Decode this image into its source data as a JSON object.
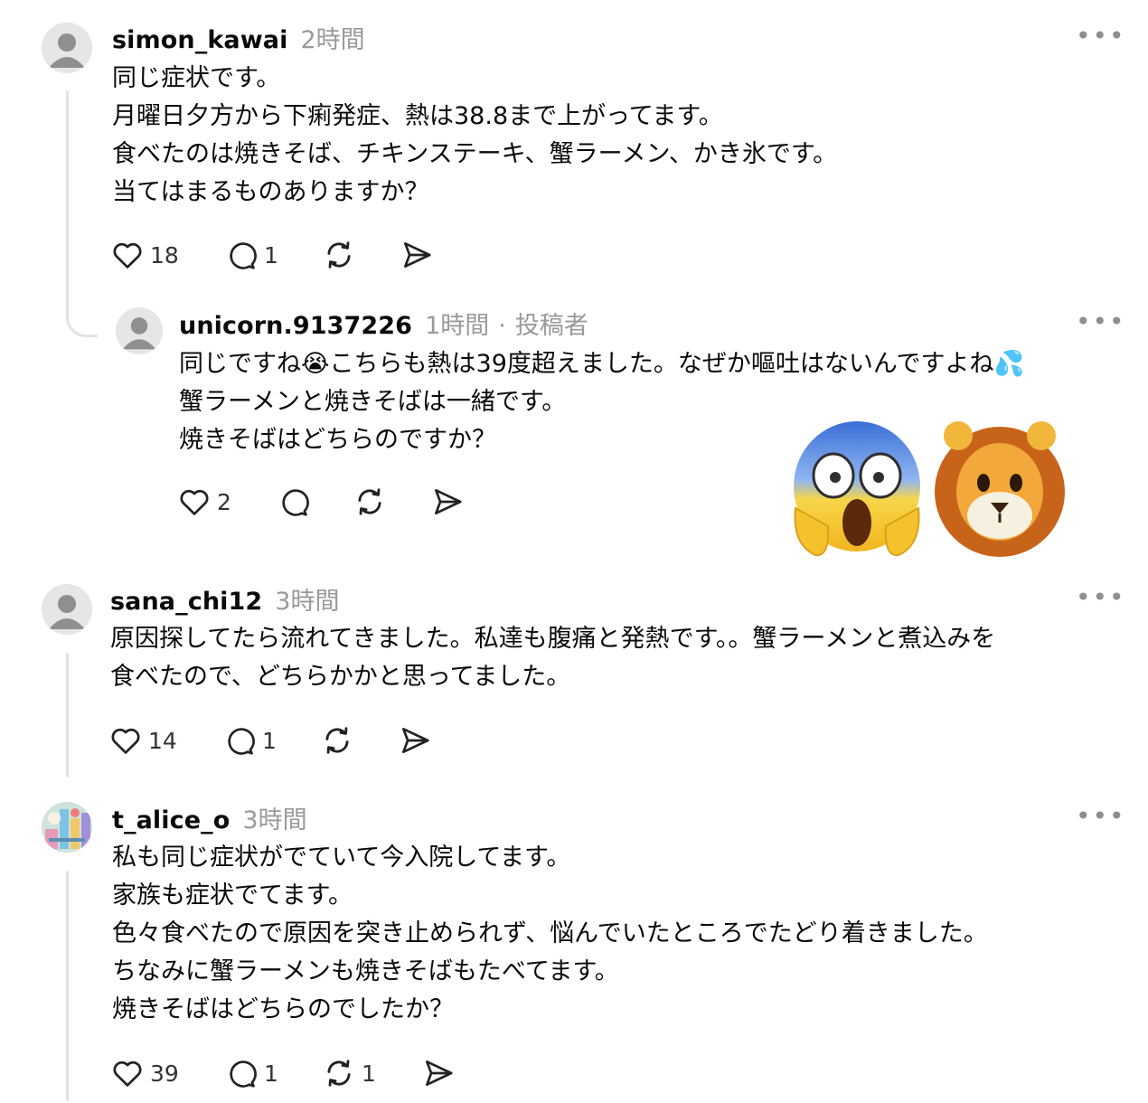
{
  "comments": [
    {
      "username": "simon_kawai",
      "time": "2時間",
      "lines": [
        "同じ症状です。",
        "月曜日夕方から下痢発症、熱は38.8まで上がってます。",
        "食べたのは焼きそば、チキンステーキ、蟹ラーメン、かき氷です。",
        "当てはまるものありますか？"
      ],
      "likes": "18",
      "replies": "1",
      "reposts": ""
    },
    {
      "username": "unicorn.9137226",
      "time": "1時間",
      "separator": "·",
      "author_tag": "投稿者",
      "lines": [
        "同じですね😭こちらも熱は39度超えました。なぜか嘔吐はないんですよね💦",
        "蟹ラーメンと焼きそばは一緒です。",
        "焼きそばはどちらのですか？"
      ],
      "likes": "2",
      "replies": "",
      "reposts": "",
      "stickers": [
        "face-screaming-in-fear",
        "lion-animoji"
      ]
    },
    {
      "username": "sana_chi12",
      "time": "3時間",
      "lines": [
        "原因探してたら流れてきました。私達も腹痛と発熱です。。蟹ラーメンと煮込みを",
        "食べたので、どちらかかと思ってました。"
      ],
      "likes": "14",
      "replies": "1",
      "reposts": ""
    },
    {
      "username": "t_alice_o",
      "time": "3時間",
      "lines": [
        "私も同じ症状がでていて今入院してます。",
        "家族も症状でてます。",
        "色々食べたので原因を突き止められず、悩んでいたところでたどり着きました。",
        "ちなみに蟹ラーメンも焼きそばもたべてます。",
        "焼きそばはどちらのでしたか？"
      ],
      "likes": "39",
      "replies": "1",
      "reposts": "1"
    }
  ],
  "more_icon_label": "•••",
  "icons": [
    "heart-icon",
    "comment-icon",
    "repost-icon",
    "share-icon",
    "more-icon",
    "avatar-default-icon"
  ]
}
